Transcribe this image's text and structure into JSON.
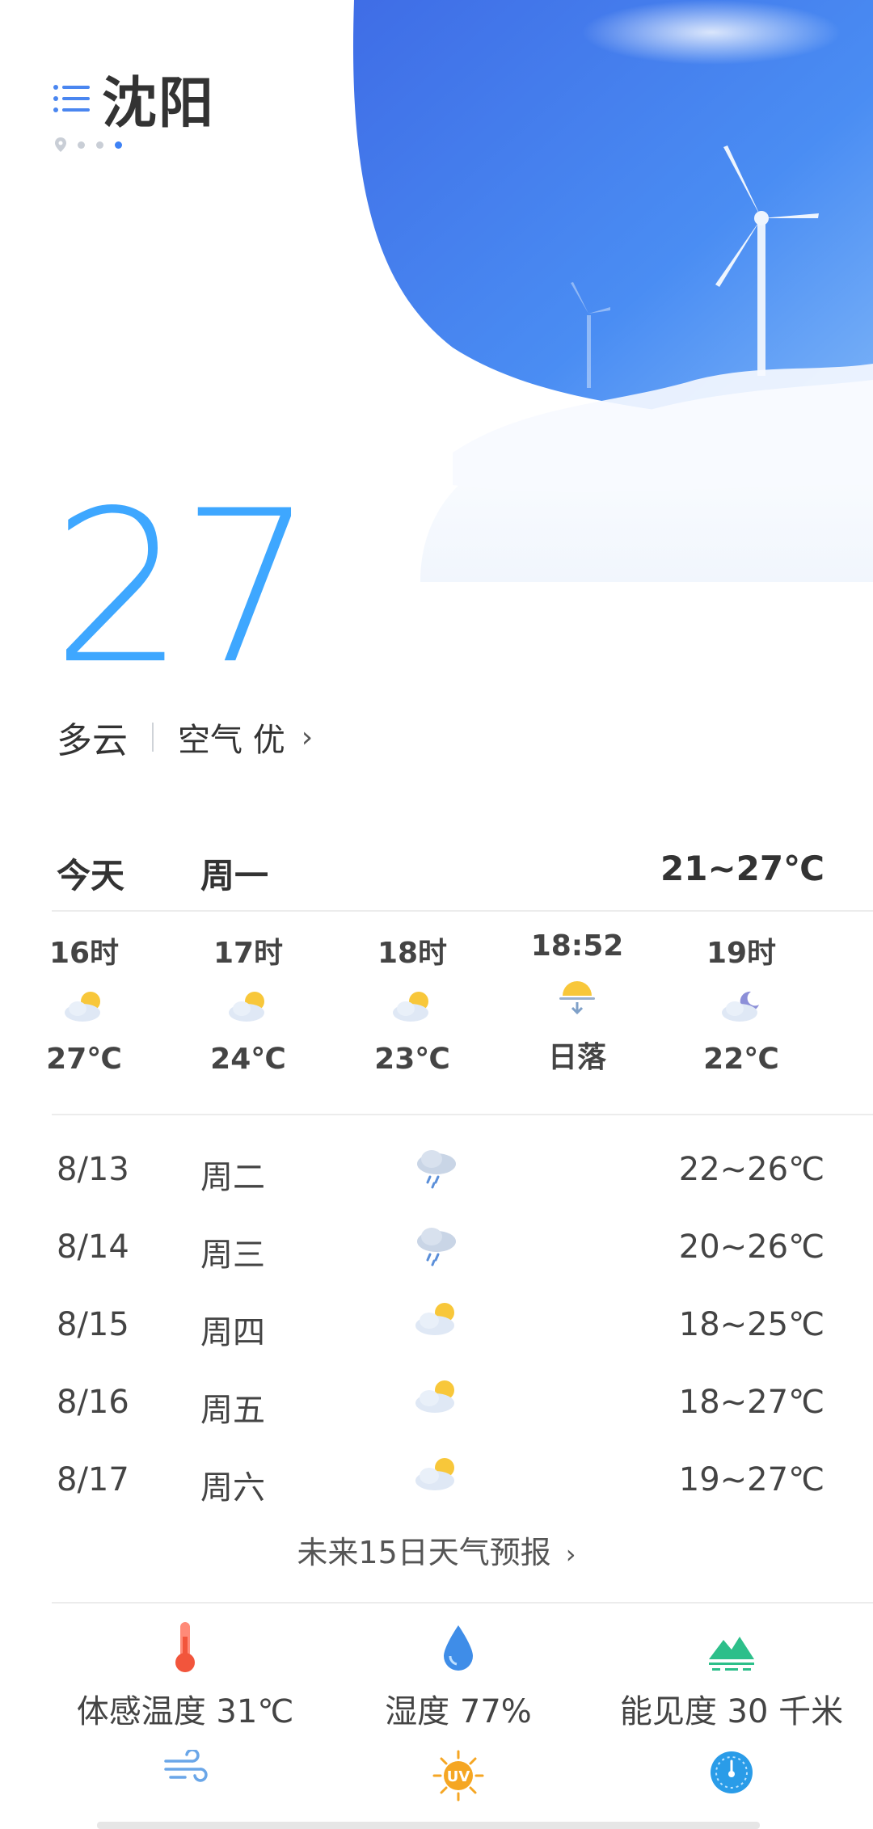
{
  "header": {
    "city": "沈阳",
    "menu_icon": "menu-icon",
    "page_count": 4,
    "active_page": 3
  },
  "current": {
    "temperature": "27",
    "condition": "多云",
    "air_quality": "空气 优",
    "air_chevron": "›"
  },
  "today": {
    "label": "今天",
    "weekday": "周一",
    "range": "21~27℃"
  },
  "hourly": [
    {
      "time": "16时",
      "icon": "partly-cloudy-day-icon",
      "value": "27℃"
    },
    {
      "time": "17时",
      "icon": "partly-cloudy-day-icon",
      "value": "24℃"
    },
    {
      "time": "18时",
      "icon": "partly-cloudy-day-icon",
      "value": "23℃"
    },
    {
      "time": "18:52",
      "icon": "sunset-icon",
      "value": "日落"
    },
    {
      "time": "19时",
      "icon": "partly-cloudy-night-icon",
      "value": "22℃"
    }
  ],
  "daily": [
    {
      "date": "8/13",
      "weekday": "周二",
      "icon": "light-rain-icon",
      "range": "22~26℃"
    },
    {
      "date": "8/14",
      "weekday": "周三",
      "icon": "light-rain-icon",
      "range": "20~26℃"
    },
    {
      "date": "8/15",
      "weekday": "周四",
      "icon": "partly-cloudy-day-icon",
      "range": "18~25℃"
    },
    {
      "date": "8/16",
      "weekday": "周五",
      "icon": "partly-cloudy-day-icon",
      "range": "18~27℃"
    },
    {
      "date": "8/17",
      "weekday": "周六",
      "icon": "partly-cloudy-day-icon",
      "range": "19~27℃"
    }
  ],
  "forecast_link": {
    "label": "未来15日天气预报",
    "chevron": "›"
  },
  "details": [
    {
      "icon": "thermometer-icon",
      "label": "体感温度 31℃"
    },
    {
      "icon": "humidity-drop-icon",
      "label": "湿度 77%"
    },
    {
      "icon": "visibility-icon",
      "label": "能见度 30 千米"
    }
  ],
  "details_more": [
    {
      "icon": "wind-icon"
    },
    {
      "icon": "uv-icon",
      "text": "UV"
    },
    {
      "icon": "pressure-gauge-icon"
    }
  ],
  "colors": {
    "accent": "#3ea7ff",
    "sky": "#3f7ef0",
    "active_dot": "#3e82f5"
  }
}
